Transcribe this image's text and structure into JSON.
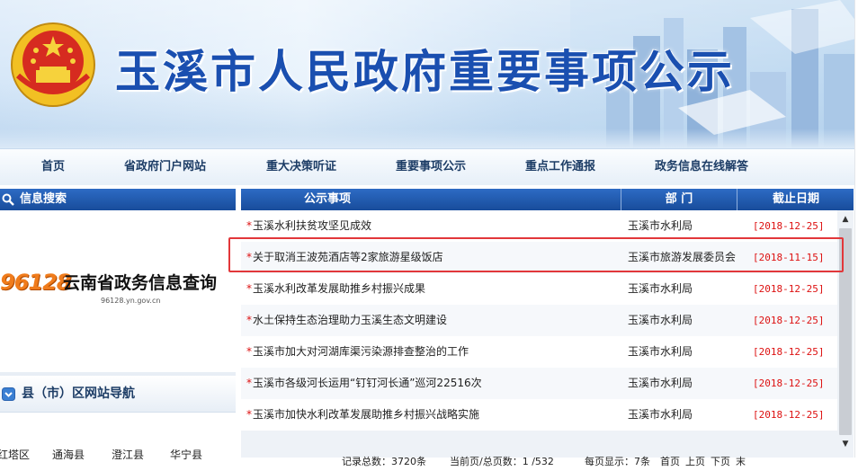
{
  "banner": {
    "title": "玉溪市人民政府重要事项公示"
  },
  "nav": {
    "items": [
      "首页",
      "省政府门户网站",
      "重大决策听证",
      "重要事项公示",
      "重点工作通报",
      "政务信息在线解答"
    ]
  },
  "left": {
    "search_title": "信息搜索",
    "logo_number": "96128",
    "logo_name": "云南省政务信息查询",
    "logo_url": "96128.yn.gov.cn",
    "county_title": "县（市）区网站导航",
    "counties": [
      "红塔区",
      "通海县",
      "澄江县",
      "华宁县"
    ]
  },
  "table": {
    "headers": {
      "title": "公示事项",
      "dept": "部 门",
      "date": "截止日期"
    },
    "star": "*",
    "rows": [
      {
        "title": "玉溪水利扶贫攻坚见成效",
        "dept": "玉溪市水利局",
        "date": "[2018-12-25]"
      },
      {
        "title": "关于取消王波苑酒店等2家旅游星级饭店",
        "dept": "玉溪市旅游发展委员会",
        "date": "[2018-11-15]"
      },
      {
        "title": "玉溪水利改革发展助推乡村振兴成果",
        "dept": "玉溪市水利局",
        "date": "[2018-12-25]"
      },
      {
        "title": "水土保持生态治理助力玉溪生态文明建设",
        "dept": "玉溪市水利局",
        "date": "[2018-12-25]"
      },
      {
        "title": "玉溪市加大对河湖库渠污染源排查整治的工作",
        "dept": "玉溪市水利局",
        "date": "[2018-12-25]"
      },
      {
        "title": "玉溪市各级河长运用“钉钉河长通”巡河22516次",
        "dept": "玉溪市水利局",
        "date": "[2018-12-25]"
      },
      {
        "title": "玉溪市加快水利改革发展助推乡村振兴战略实施",
        "dept": "玉溪市水利局",
        "date": "[2018-12-25]"
      }
    ]
  },
  "pager": {
    "total": "记录总数：3720条",
    "page": "当前页/总页数：1 /532",
    "per_page": "每页显示：7条",
    "first": "首页",
    "prev": "上页",
    "next": "下页",
    "last": "末"
  },
  "colors": {
    "header_blue": "#184c9b",
    "date_red": "#dd1111",
    "highlight_red": "#e2373a",
    "title_blue": "#1a4fb0"
  }
}
